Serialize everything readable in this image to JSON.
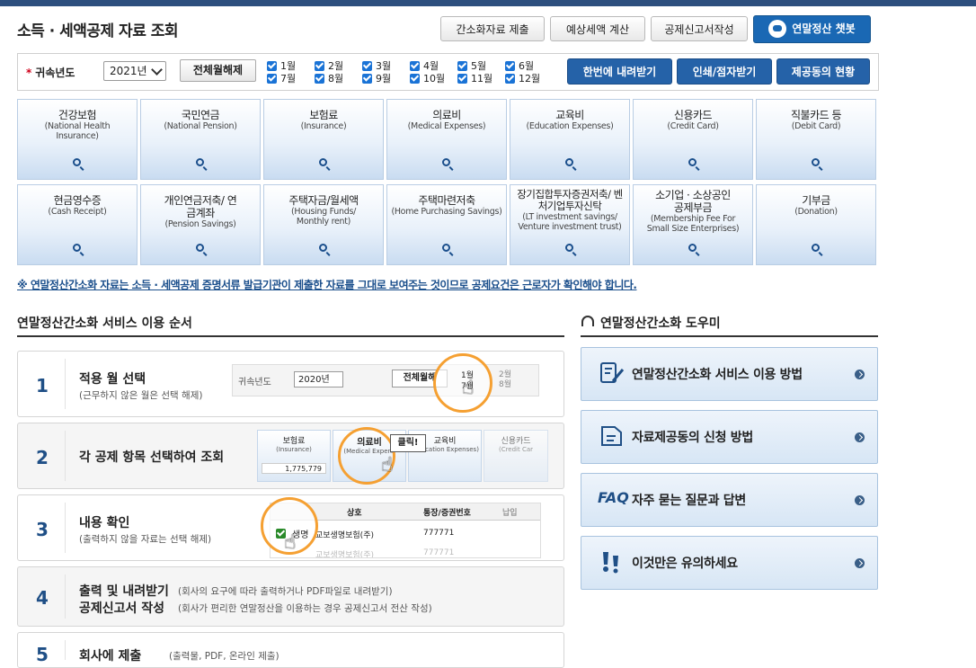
{
  "page": {
    "title": "소득 · 세액공제 자료 조회"
  },
  "top_buttons": {
    "simplified_submit": "간소화자료 제출",
    "tax_estimate": "예상세액 계산",
    "deduction_form": "공제신고서작성",
    "chatbot": "연말정산 챗봇"
  },
  "filter": {
    "year_label": "귀속년도",
    "year_value": "2021년",
    "reset_button": "전체월해제",
    "months": [
      "1월",
      "2월",
      "3월",
      "4월",
      "5월",
      "6월",
      "7월",
      "8월",
      "9월",
      "10월",
      "11월",
      "12월"
    ],
    "download_button": "한번에 내려받기",
    "print_button": "인쇄/점자받기",
    "consent_button": "제공동의 현황"
  },
  "categories": [
    {
      "ko": "건강보험",
      "en": "(National Health Insurance)"
    },
    {
      "ko": "국민연금",
      "en": "(National Pension)"
    },
    {
      "ko": "보험료",
      "en": "(Insurance)"
    },
    {
      "ko": "의료비",
      "en": "(Medical Expenses)"
    },
    {
      "ko": "교육비",
      "en": "(Education Expenses)"
    },
    {
      "ko": "신용카드",
      "en": "(Credit Card)"
    },
    {
      "ko": "직불카드 등",
      "en": "(Debit Card)"
    },
    {
      "ko": "현금영수증",
      "en": "(Cash Receipt)"
    },
    {
      "ko": "개인연금저축/ 연금계좌",
      "en": "(Pension Savings)"
    },
    {
      "ko": "주택자금/월세액",
      "en": "(Housing Funds/ Monthly rent)"
    },
    {
      "ko": "주택마련저축",
      "en": "(Home Purchasing Savings)"
    },
    {
      "ko": "장기집합투자증권저축/ 벤처기업투자신탁",
      "en": "(LT investment savings/ Venture investment trust)"
    },
    {
      "ko": "소기업 · 소상공인 공제부금",
      "en": "(Membership Fee For Small Size Enterprises)"
    },
    {
      "ko": "기부금",
      "en": "(Donation)"
    }
  ],
  "notice": "※ 연말정산간소화 자료는 소득 · 세액공제 증명서류 발급기관이 제출한 자료를 그대로 보여주는 것이므로 공제요건은 근로자가 확인해야 합니다.",
  "steps_section": {
    "title": "연말정산간소화 서비스 이용 순서",
    "steps": [
      {
        "num": "1",
        "title": "적용 월 선택",
        "sub": "(근무하지 않은 월은 선택 해제)"
      },
      {
        "num": "2",
        "title": "각 공제 항목 선택하여 조회",
        "sub": ""
      },
      {
        "num": "3",
        "title": "내용 확인",
        "sub": "(출력하지 않을 자료는 선택 해제)"
      },
      {
        "num": "4",
        "title": "출력 및 내려받기",
        "sub": "(회사의 요구에 따라 출력하거나 PDF파일로 내려받기)",
        "title2": "공제신고서 작성",
        "sub2": "(회사가 편리한 연말정산을 이용하는 경우 공제신고서 전산 작성)"
      },
      {
        "num": "5",
        "title": "회사에 제출",
        "sub": "(출력물, PDF, 온라인 제출)"
      }
    ],
    "illu1": {
      "year_label": "귀속년도",
      "year_value": "2020년",
      "reset": "전체월해",
      "m1": "1월",
      "m2": "2월",
      "m7": "7월",
      "m8": "8월"
    },
    "illu2": {
      "t1": "보험료",
      "t1e": "(Insurance)",
      "v1": "1,775,779",
      "t2": "의료비",
      "t2e": "(Medical Expens",
      "t3": "교육비",
      "t3e": "(Education Expenses)",
      "t4": "신용카드",
      "t4e": "(Credit Car",
      "click": "클릭!"
    },
    "illu3": {
      "col1": "상호",
      "col2": "통장/증권번호",
      "col3": "납입",
      "row1": "생명",
      "row1b": "교보생명보험(주)",
      "row1c": "777771",
      "row2": "교보생명보험(주)",
      "row2c": "777771"
    }
  },
  "help_section": {
    "title": "연말정산간소화 도우미",
    "items": [
      {
        "icon": "document-edit-icon",
        "label": "연말정산간소화 서비스 이용 방법"
      },
      {
        "icon": "file-icon",
        "label": "자료제공동의 신청 방법"
      },
      {
        "icon": "faq-icon",
        "label": "자주 묻는 질문과 답변",
        "badge": "FAQ"
      },
      {
        "icon": "exclamation-icon",
        "label": "이것만은 유의하세요"
      }
    ]
  }
}
